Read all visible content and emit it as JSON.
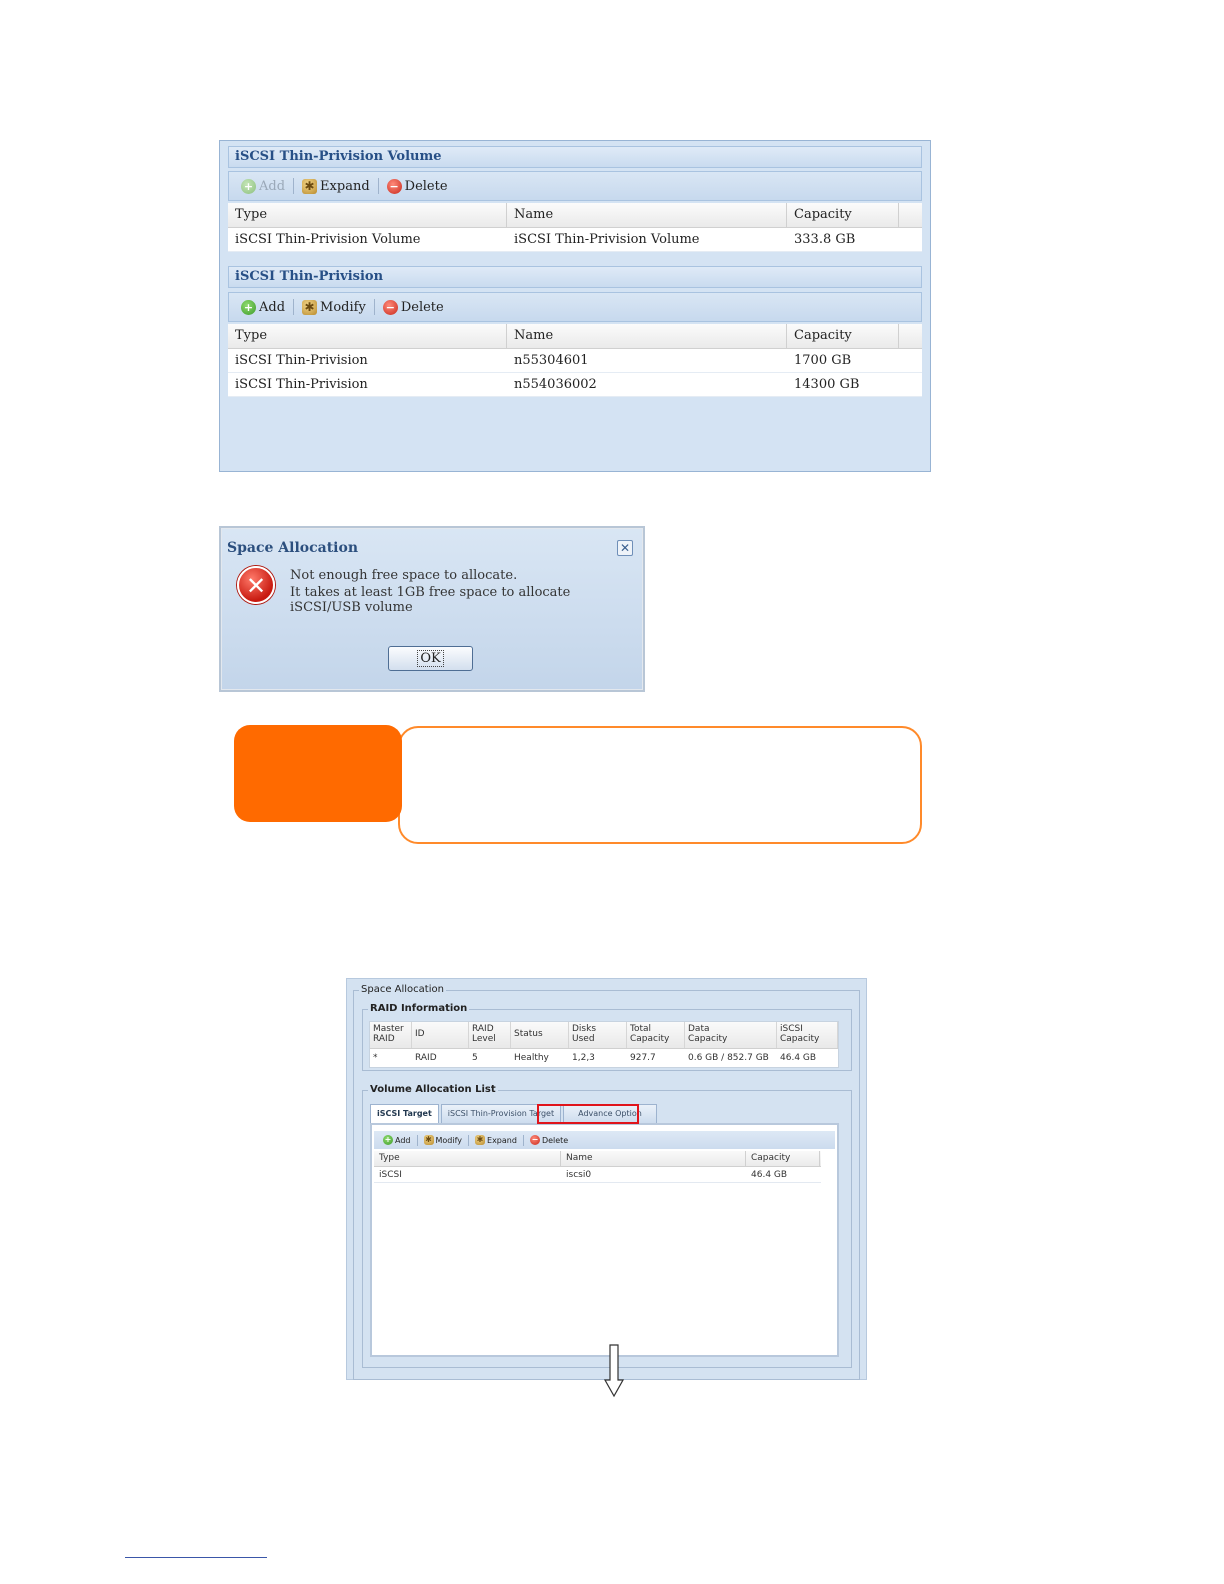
{
  "thin_volume": {
    "title": "iSCSI Thin-Privision Volume",
    "toolbar": {
      "add": "Add",
      "expand": "Expand",
      "delete": "Delete"
    },
    "columns": [
      "Type",
      "Name",
      "Capacity"
    ],
    "rows": [
      [
        "iSCSI Thin-Privision Volume",
        "iSCSI Thin-Privision Volume",
        "333.8 GB"
      ]
    ]
  },
  "thin_provision": {
    "title": "iSCSI Thin-Privision",
    "toolbar": {
      "add": "Add",
      "modify": "Modify",
      "delete": "Delete"
    },
    "columns": [
      "Type",
      "Name",
      "Capacity"
    ],
    "rows": [
      [
        "iSCSI Thin-Privision",
        "n55304601",
        "1700 GB"
      ],
      [
        "iSCSI Thin-Privision",
        "n554036002",
        "14300 GB"
      ]
    ]
  },
  "dialog": {
    "title": "Space Allocation",
    "close": "✕",
    "message_line1": "Not enough free space to allocate.",
    "message_line2": "It takes at least 1GB free space to allocate iSCSI/USB volume",
    "ok": "OK"
  },
  "space_allocation": {
    "title": "Space Allocation",
    "raid_info": {
      "legend": "RAID Information",
      "columns": [
        "Master\nRAID",
        "ID",
        "RAID\nLevel",
        "Status",
        "Disks\nUsed",
        "Total\nCapacity",
        "Data\nCapacity",
        "iSCSI\nCapacity"
      ],
      "row": [
        "*",
        "RAID",
        "5",
        "Healthy",
        "1,2,3",
        "927.7",
        "0.6 GB / 852.7 GB",
        "46.4 GB"
      ]
    },
    "volume_list": {
      "legend": "Volume Allocation List",
      "tabs": [
        "iSCSI Target",
        "iSCSI Thin-Provision Target",
        "Advance Option"
      ],
      "toolbar": {
        "add": "Add",
        "modify": "Modify",
        "expand": "Expand",
        "delete": "Delete"
      },
      "columns": [
        "Type",
        "Name",
        "Capacity"
      ],
      "rows": [
        [
          "iSCSI",
          "iscsi0",
          "46.4 GB"
        ]
      ]
    }
  },
  "colors": {
    "callout_orange": "#ff6a00",
    "highlight_red": "#e0141b"
  }
}
